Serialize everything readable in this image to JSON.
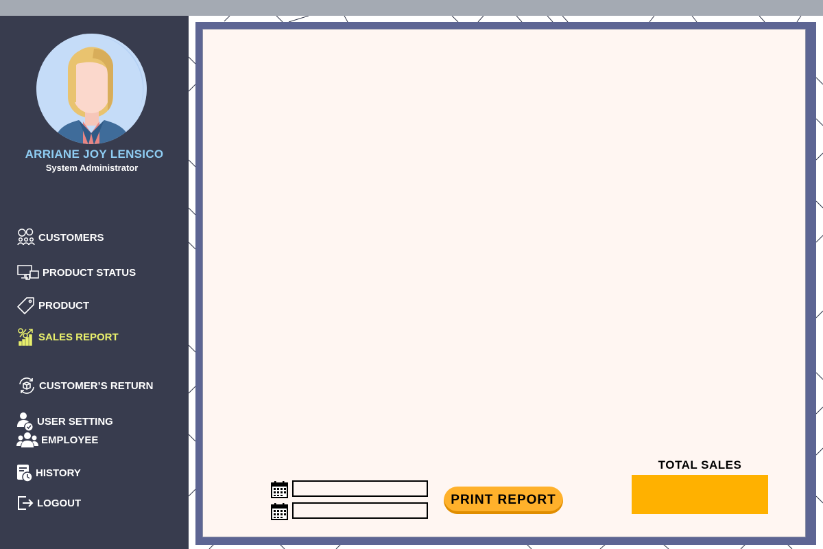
{
  "colors": {
    "sidebar_bg": "#383c4e",
    "active_nav": "#e8ef6c",
    "user_name": "#8fcdf3",
    "panel_border": "#5d6593",
    "panel_bg": "#fff6f2",
    "accent": "#ffb100"
  },
  "user": {
    "name": "ARRIANE JOY LENSICO",
    "role": "System Administrator"
  },
  "nav": [
    {
      "label": "CUSTOMERS",
      "icon": "customers-icon"
    },
    {
      "label": "PRODUCT STATUS",
      "icon": "devices-icon"
    },
    {
      "label": "PRODUCT",
      "icon": "tag-icon"
    },
    {
      "label": "SALES REPORT",
      "icon": "sales-chart-icon",
      "active": true
    },
    {
      "label": "CUSTOMER’S RETURN",
      "icon": "return-box-icon"
    },
    {
      "label": "USER SETTING",
      "icon": "user-check-icon"
    },
    {
      "label": "EMPLOYEE",
      "icon": "group-icon"
    },
    {
      "label": "HISTORY",
      "icon": "history-icon"
    },
    {
      "label": "LOGOUT",
      "icon": "logout-icon"
    }
  ],
  "report": {
    "date_from": {
      "value": "",
      "placeholder": ""
    },
    "date_to": {
      "value": "",
      "placeholder": ""
    },
    "print_label": "PRINT REPORT",
    "total_label": "TOTAL SALES",
    "total_value": ""
  }
}
